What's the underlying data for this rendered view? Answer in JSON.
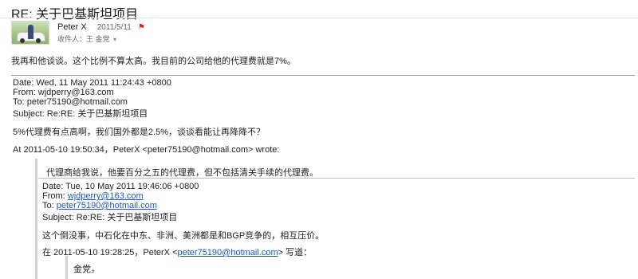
{
  "email": {
    "subject": "RE: 关于巴基斯坦项目",
    "sender_name": "Peter X",
    "sent_date": "2011/5/11",
    "recipient_label": "收件人：王 金党",
    "reply_body": "我再和他谈谈。这个比例不算太高。我目前的公司给他的代理费就是7%。"
  },
  "quoted_1": {
    "date": "Date: Wed, 11 May 2011 11:24:43 +0800",
    "from": "From: wjdperry@163.com",
    "to": "To: peter75190@hotmail.com",
    "subject": "Subject: Re:RE: 关于巴基斯坦项目",
    "body": "5%代理费有点高啊，我们国外都是2.5%，谈谈看能让再降降不？",
    "attribution": "At 2011-05-10 19:50:34，PeterX <peter75190@hotmail.com> wrote:"
  },
  "quoted_2": {
    "intro": "代理商给我说，他要百分之五的代理费，但不包括清关手续的代理费。",
    "date": "Date: Tue, 10 May 2011 19:46:06 +0800",
    "from_label": "From: ",
    "from_email": "wjdperry@163.com",
    "to_label": "To: ",
    "to_email": "peter75190@hotmail.com",
    "subject": "Subject: Re:RE: 关于巴基斯坦项目",
    "body": "这个倒没事，中石化在中东、非洲、美洲都是和BGP竞争的，相互压价。",
    "attr_prefix": "在 2011-05-10 19:28:25，PeterX <",
    "attr_email": "peter75190@hotmail.com",
    "attr_suffix": "> 写道：",
    "greeting": "金党，"
  }
}
